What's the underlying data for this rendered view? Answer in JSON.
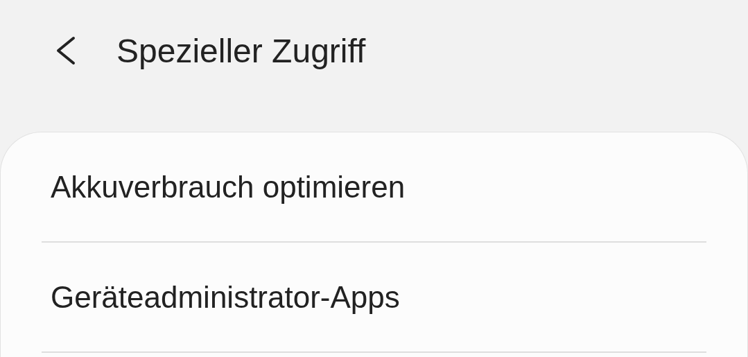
{
  "header": {
    "title": "Spezieller Zugriff"
  },
  "items": [
    {
      "label": "Akkuverbrauch optimieren"
    },
    {
      "label": "Geräteadministrator-Apps"
    }
  ]
}
